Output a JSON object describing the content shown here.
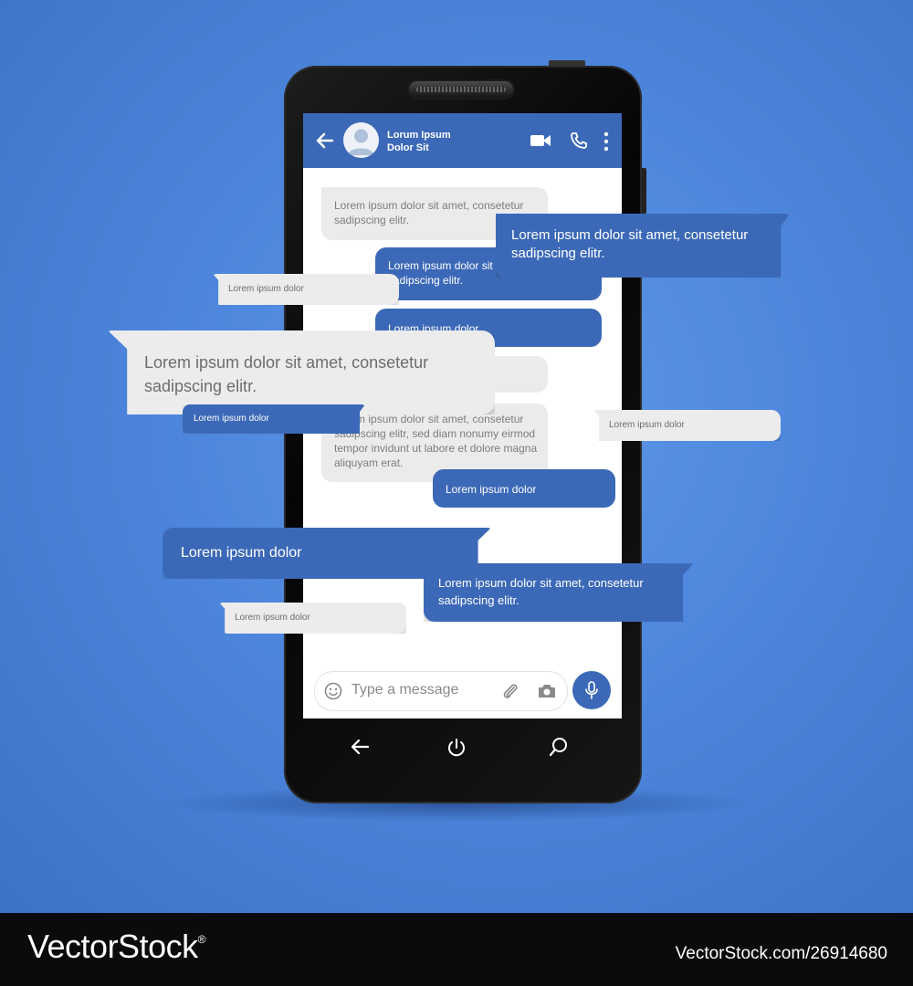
{
  "chat": {
    "contact_name_line1": "Lorum Ipsum",
    "contact_name_line2": "Dolor Sit",
    "input_placeholder": "Type a message",
    "messages": [
      {
        "side": "in",
        "text": "Lorem ipsum dolor sit amet, consetetur sadipscing elitr."
      },
      {
        "side": "out",
        "text": "Lorem ipsum dolor sit amet, consetetur sadipscing elitr."
      },
      {
        "side": "out",
        "text": "Lorem ipsum dolor"
      },
      {
        "side": "in",
        "text": "Lorem ipsum dolor sit amet, consetetur sadipscing elitr, sed diam nonumy eirmod tempor invidunt ut labore et dolore magna aliquyam erat."
      },
      {
        "side": "out",
        "text": "Lorem ipsum dolor"
      }
    ]
  },
  "floating_bubbles": [
    {
      "color": "blue",
      "text": "Lorem ipsum dolor sit amet, consetetur sadipscing elitr."
    },
    {
      "color": "grey",
      "text": "Lorem ipsum dolor"
    },
    {
      "color": "grey",
      "text": "Lorem ipsum dolor sit amet, consetetur sadipscing elitr."
    },
    {
      "color": "blue",
      "text": "Lorem ipsum dolor"
    },
    {
      "color": "grey",
      "text": "Lorem ipsum dolor"
    },
    {
      "color": "blue",
      "text": "Lorem ipsum dolor"
    },
    {
      "color": "blue",
      "text": "Lorem ipsum dolor sit amet, consetetur sadipscing elitr."
    },
    {
      "color": "grey",
      "text": "Lorem ipsum dolor"
    }
  ],
  "icons": {
    "header": [
      "back-arrow-icon",
      "avatar-icon",
      "video-call-icon",
      "phone-icon",
      "more-vertical-icon"
    ],
    "input": [
      "emoji-icon",
      "paperclip-icon",
      "camera-icon",
      "microphone-icon"
    ],
    "navbar": [
      "nav-back-icon",
      "power-icon",
      "search-icon"
    ]
  },
  "colors": {
    "background": "#4d86dc",
    "accent": "#3c69b7",
    "bubble_in": "#ebebeb",
    "footer": "#0b0b0b"
  },
  "watermark": {
    "brand": "VectorStock",
    "registered": "®",
    "reference": "VectorStock.com/26914680"
  }
}
